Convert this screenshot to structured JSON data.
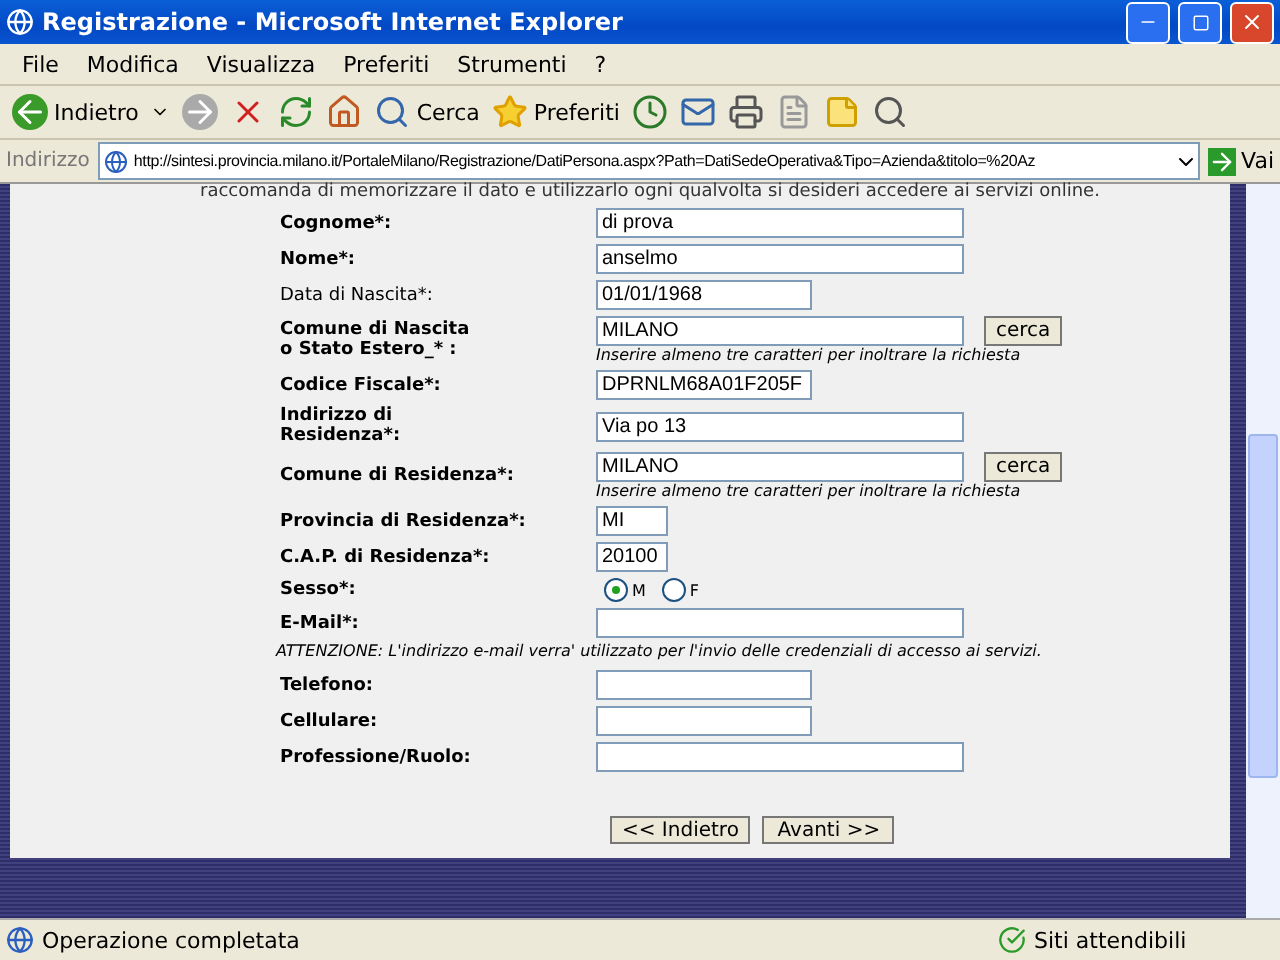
{
  "window": {
    "title": "Registrazione - Microsoft Internet Explorer"
  },
  "menu": [
    "File",
    "Modifica",
    "Visualizza",
    "Preferiti",
    "Strumenti",
    "?"
  ],
  "toolbar": {
    "back": "Indietro",
    "search": "Cerca",
    "favorites": "Preferiti"
  },
  "address_bar": {
    "label": "Indirizzo",
    "url": "http://sintesi.provincia.milano.it/PortaleMilano/Registrazione/DatiPersona.aspx?Path=DatiSedeOperativa&Tipo=Azienda&titolo=%20Az",
    "go": "Vai"
  },
  "intro": "raccomanda di memorizzare il dato e utilizzarlo ogni qualvolta si desideri accedere ai servizi online.",
  "fields": [
    {
      "kind": "long",
      "label": "Cognome*:",
      "bold": true,
      "value": "di prova"
    },
    {
      "kind": "long",
      "label": "Nome*:",
      "bold": true,
      "value": "anselmo"
    },
    {
      "kind": "medium",
      "label": "Data di Nascita*:",
      "bold": false,
      "value": "01/01/1968"
    },
    {
      "kind": "long",
      "label": "Comune di Nascita\no Stato Estero_* :",
      "bold": true,
      "value": "MILANO",
      "button": "cerca",
      "hint": "Inserire almeno tre caratteri per inoltrare la richiesta"
    },
    {
      "kind": "medium",
      "label": "Codice Fiscale*:",
      "bold": true,
      "value": "DPRNLM68A01F205F"
    },
    {
      "kind": "long",
      "label": "Indirizzo di\nResidenza*:",
      "bold": true,
      "value": "Via po 13"
    },
    {
      "kind": "long",
      "label": "Comune di Residenza*:",
      "bold": true,
      "value": "MILANO",
      "button": "cerca",
      "hint": "Inserire almeno tre caratteri per inoltrare la richiesta"
    },
    {
      "kind": "tiny",
      "label": "Provincia di Residenza*:",
      "bold": true,
      "value": "MI"
    },
    {
      "kind": "tiny",
      "label": "C.A.P. di Residenza*:",
      "bold": true,
      "value": "20100"
    },
    {
      "kind": "radio",
      "label": "Sesso*:",
      "bold": true,
      "options": [
        {
          "label": "M",
          "selected": true
        },
        {
          "label": "F",
          "selected": false
        }
      ]
    },
    {
      "kind": "long",
      "label": "E-Mail*:",
      "bold": true
    },
    {
      "kind": "note",
      "label": "ATTENZIONE: L'indirizzo e-mail verra' utilizzato per l'invio delle credenziali di accesso ai servizi."
    },
    {
      "kind": "medium",
      "label": "Telefono:",
      "bold": true
    },
    {
      "kind": "medium",
      "label": "Cellulare:",
      "bold": true
    },
    {
      "kind": "long",
      "label": "Professione/Ruolo:",
      "bold": true
    }
  ],
  "buttons": [
    "<< Indietro",
    "Avanti >>"
  ],
  "status_bar": {
    "text": "Operazione completata",
    "zone": "Siti attendibili"
  }
}
